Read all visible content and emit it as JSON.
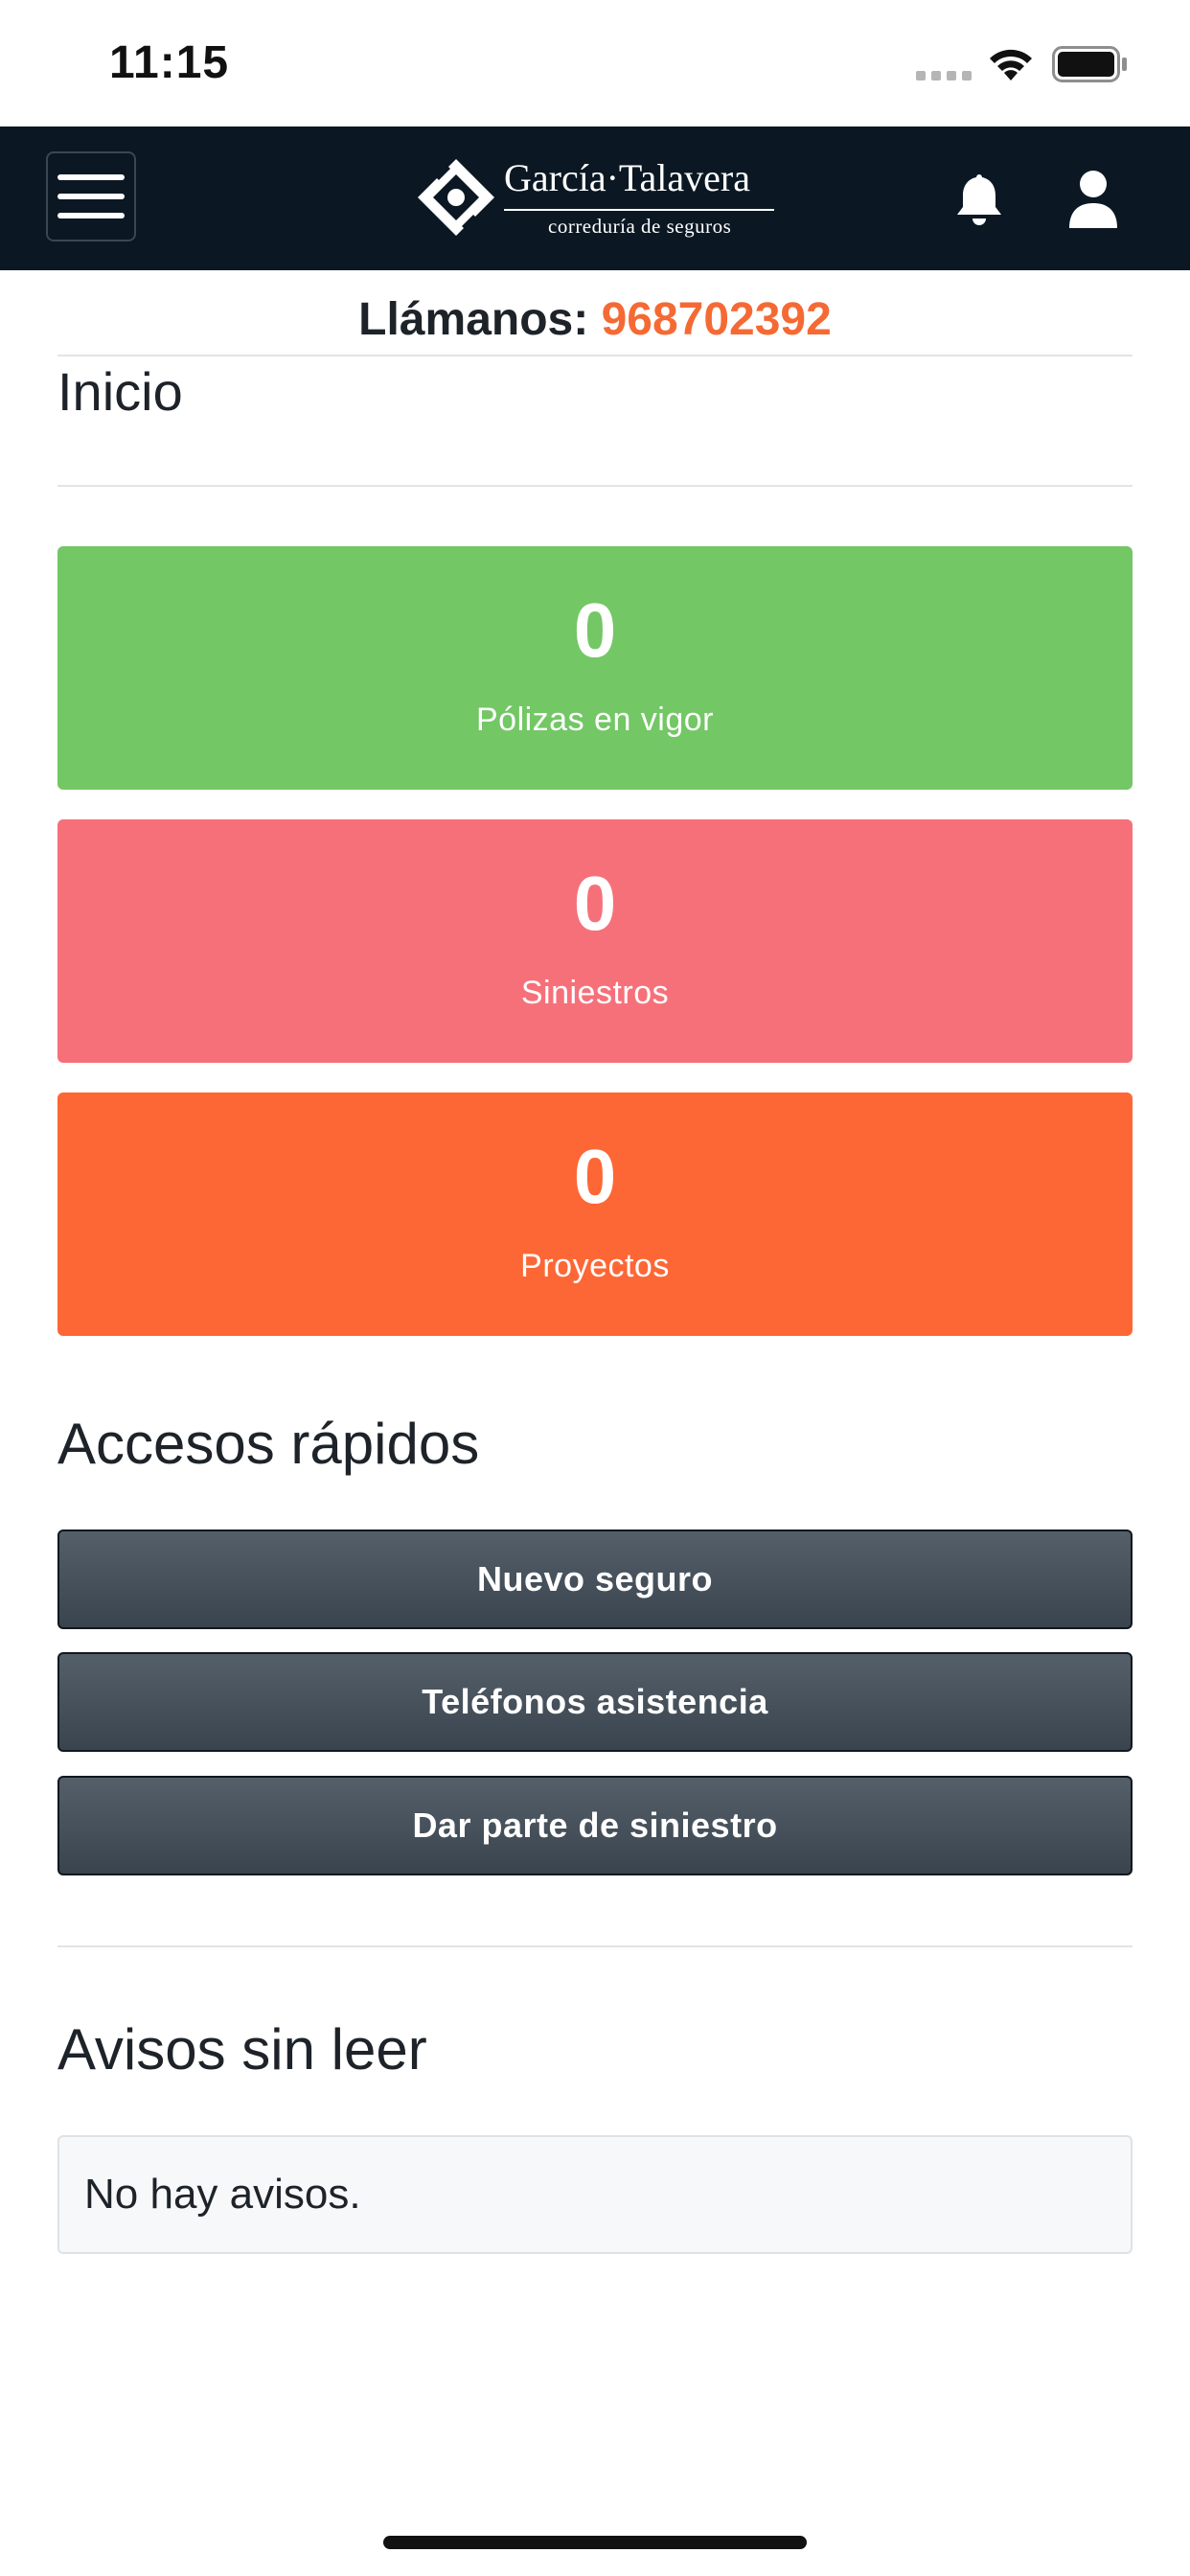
{
  "status_bar": {
    "time": "11:15"
  },
  "navbar": {
    "logo_name": "García·Talavera",
    "logo_subtitle": "correduría de seguros"
  },
  "contact": {
    "label": "Llámanos:",
    "phone": "968702392",
    "phone_color": "#f56a34"
  },
  "page": {
    "title": "Inicio"
  },
  "stats": [
    {
      "value": "0",
      "label": "Pólizas en vigor",
      "color": "#73c765"
    },
    {
      "value": "0",
      "label": "Siniestros",
      "color": "#f6707a"
    },
    {
      "value": "0",
      "label": "Proyectos",
      "color": "#fd6735"
    }
  ],
  "quick_access": {
    "title": "Accesos rápidos",
    "buttons": [
      {
        "label": "Nuevo seguro"
      },
      {
        "label": "Teléfonos asistencia"
      },
      {
        "label": "Dar parte de siniestro"
      }
    ]
  },
  "notices": {
    "title": "Avisos sin leer",
    "empty_text": "No hay avisos."
  },
  "colors": {
    "navbar_bg": "#0b1823",
    "button_bg": "#4a545e"
  }
}
